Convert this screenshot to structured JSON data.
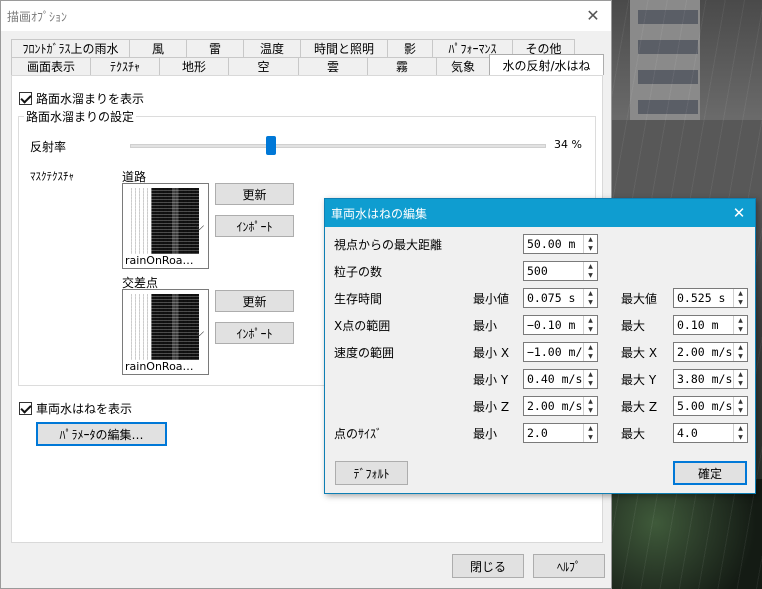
{
  "window": {
    "title": "描画ｵﾌﾟｼｮﾝ",
    "close": "✕"
  },
  "tabs_row1": [
    "ﾌﾛﾝﾄｶﾞﾗｽ上の雨水",
    "風",
    "雷",
    "温度",
    "時間と照明",
    "影",
    "ﾊﾟﾌｫｰﾏﾝｽ",
    "その他"
  ],
  "tabs_row2": [
    "画面表示",
    "ﾃｸｽﾁｬ",
    "地形",
    "空",
    "雲",
    "霧",
    "気象",
    "水の反射/水はね"
  ],
  "puddle": {
    "show_label": "路面水溜まりを表示",
    "show_checked": true,
    "group_title": "路面水溜まりの設定",
    "reflect_label": "反射率",
    "reflect_value": "34 %",
    "reflect_level": 0.34,
    "mask_label": "ﾏｽｸﾃｸｽﾁｬ",
    "road_label": "道路",
    "road_tex": "rainOnRoa…",
    "cross_label": "交差点",
    "cross_tex": "rainOnRoa…",
    "update_btn": "更新",
    "import_btn": "ｲﾝﾎﾟｰﾄ"
  },
  "splash": {
    "show_label": "車両水はねを表示",
    "show_checked": true,
    "param_btn": "ﾊﾟﾗﾒｰﾀの編集…"
  },
  "footer": {
    "close_btn": "閉じる",
    "help_btn": "ﾍﾙﾌﾟ"
  },
  "popup": {
    "title": "車両水はねの編集",
    "close": "✕",
    "rows": {
      "max_dist": {
        "label": "視点からの最大距離",
        "value": "50.00 m"
      },
      "particles": {
        "label": "粒子の数",
        "value": "500"
      },
      "lifetime": {
        "label": "生存時間",
        "min_label": "最小値",
        "min": "0.075 s",
        "max_label": "最大値",
        "max": "0.525 s"
      },
      "x_range": {
        "label": "X点の範囲",
        "min_label": "最小",
        "min": "−0.10 m",
        "max_label": "最大",
        "max": "0.10 m"
      },
      "vel_x": {
        "label": "速度の範囲",
        "min_label": "最小 X",
        "min": "−1.00 m/s",
        "max_label": "最大 X",
        "max": "2.00 m/s"
      },
      "vel_y": {
        "min_label": "最小 Y",
        "min": "0.40 m/s",
        "max_label": "最大 Y",
        "max": "3.80 m/s"
      },
      "vel_z": {
        "min_label": "最小 Z",
        "min": "2.00 m/s",
        "max_label": "最大 Z",
        "max": "5.00 m/s"
      },
      "size": {
        "label": "点のｻｲｽﾞ",
        "min_label": "最小",
        "min": "2.0",
        "max_label": "最大",
        "max": "4.0"
      }
    },
    "default_btn": "ﾃﾞﾌｫﾙﾄ",
    "ok_btn": "確定"
  }
}
